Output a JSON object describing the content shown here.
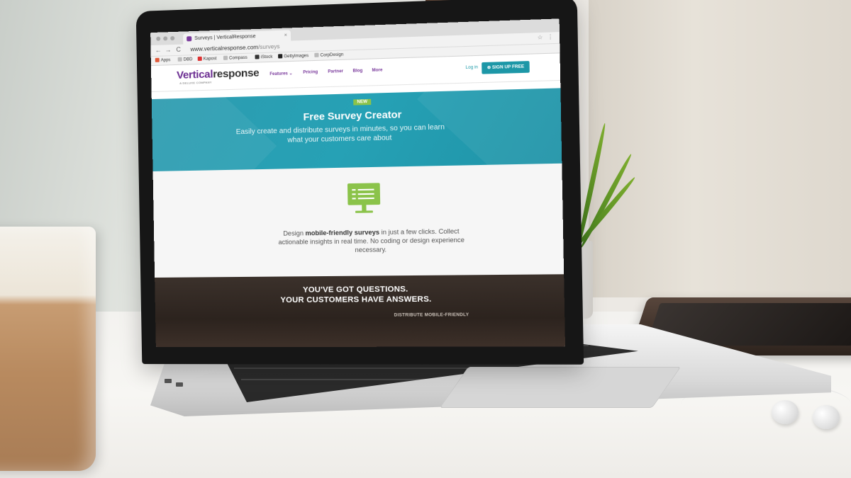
{
  "browser": {
    "tab_title": "Surveys | VerticalResponse",
    "tab_close": "×",
    "url_host": "www.verticalresponse.com",
    "url_path": "/surveys",
    "back_icon": "←",
    "forward_icon": "→",
    "reload_icon": "C",
    "star_icon": "☆",
    "menu_icon": "⋮",
    "bookmarks": [
      "Apps",
      "DBD",
      "Kapost",
      "Compass",
      "iStock",
      "GettyImages",
      "CorpDesign"
    ]
  },
  "site": {
    "logo_primary": "Vertical",
    "logo_secondary": "response",
    "logo_tagline": "A DELUXE COMPANY",
    "nav": [
      "Features ⌄",
      "Pricing",
      "Partner",
      "Blog",
      "More"
    ],
    "login": "Log in",
    "signup": "⊕ SIGN UP FREE"
  },
  "hero": {
    "badge": "NEW",
    "title": "Free Survey Creator",
    "subtitle": "Easily create and distribute surveys in minutes, so you can learn what your customers care about"
  },
  "feature": {
    "icon": "monitor-checklist-icon",
    "text_before": "Design ",
    "text_bold": "mobile-friendly surveys",
    "text_after": " in just a few clicks. Collect actionable insights in real time. No coding or design experience necessary."
  },
  "dark_section": {
    "title_line1": "YOU'VE GOT QUESTIONS.",
    "title_line2": "YOUR CUSTOMERS HAVE ANSWERS.",
    "peek_text": "DISTRIBUTE MOBILE-FRIENDLY"
  },
  "colors": {
    "brand_purple": "#6a2c91",
    "teal": "#1d97a7",
    "green": "#8bc34a"
  }
}
